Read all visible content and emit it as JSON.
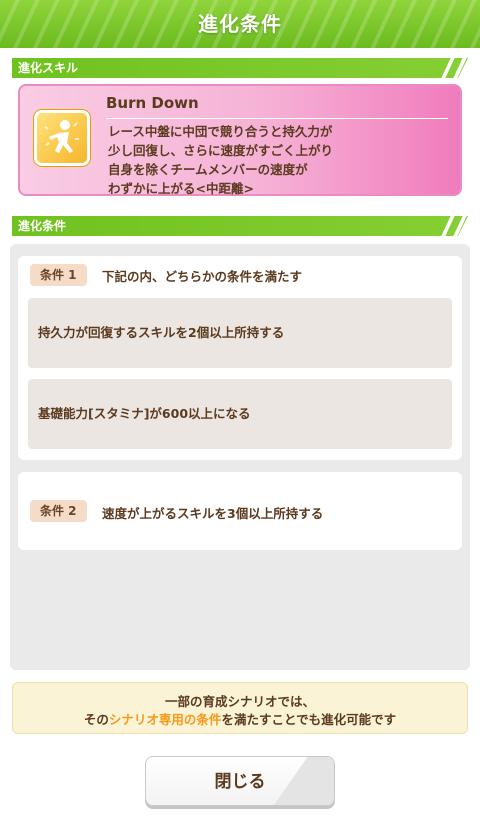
{
  "header": {
    "title": "進化条件"
  },
  "sections": {
    "skill_label": "進化スキル",
    "condition_label": "進化条件"
  },
  "skill": {
    "icon": "running-figure-icon",
    "name": "Burn Down",
    "description": [
      "レース中盤に中団で競り合うと持久力が",
      "少し回復し、さらに速度がすごく上がり",
      "自身を除くチームメンバーの速度が",
      "わずかに上がる<中距離>"
    ]
  },
  "conditions": [
    {
      "tag": "条件 1",
      "text": "下記の内、どちらかの条件を満たす",
      "sub": [
        "持久力が回復するスキルを2個以上所持する",
        "基礎能力[スタミナ]が600以上になる"
      ]
    },
    {
      "tag": "条件 2",
      "text": "速度が上がるスキルを3個以上所持する"
    }
  ],
  "note": {
    "line1": "一部の育成シナリオでは、",
    "line2_pre": "その",
    "line2_highlight": "シナリオ専用の条件",
    "line2_post": "を満たすことでも進化可能です"
  },
  "close_button": {
    "label": "閉じる"
  },
  "colors": {
    "header_green": "#7cc82a",
    "skill_card_pink": "#f6b2d6",
    "highlight_orange": "#f59a1c",
    "text_brown": "#5b3a1e"
  }
}
